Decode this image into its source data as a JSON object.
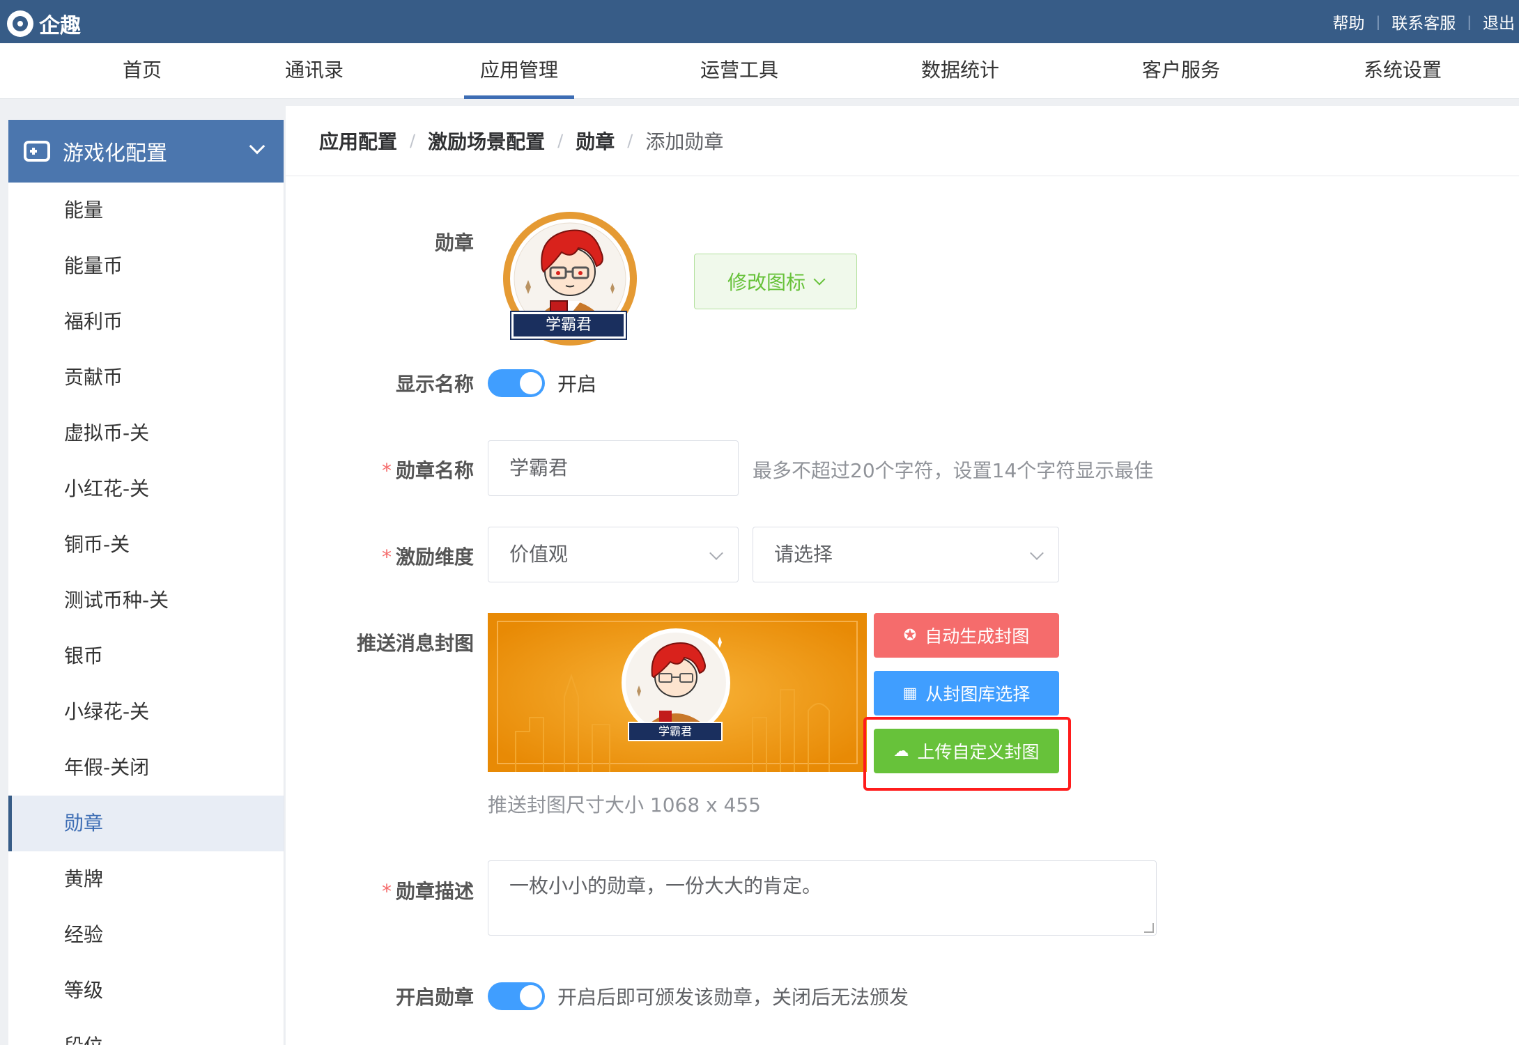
{
  "app": {
    "logo_text": "企趣"
  },
  "toplinks": [
    "帮助",
    "联系客服",
    "退出"
  ],
  "nav": {
    "items": [
      "首页",
      "通讯录",
      "应用管理",
      "运营工具",
      "数据统计",
      "客户服务",
      "系统设置"
    ],
    "active": "应用管理"
  },
  "sidebar": {
    "header": "游戏化配置",
    "items": [
      "能量",
      "能量币",
      "福利币",
      "贡献币",
      "虚拟币-关",
      "小红花-关",
      "铜币-关",
      "测试币种-关",
      "银币",
      "小绿花-关",
      "年假-关闭",
      "勋章",
      "黄牌",
      "经验",
      "等级",
      "段位"
    ],
    "active": "勋章"
  },
  "breadcrumb": [
    "应用配置",
    "激励场景配置",
    "勋章",
    "添加勋章"
  ],
  "form": {
    "badge_label": "勋章",
    "badge_caption": "学霸君",
    "modify_icon_button": "修改图标",
    "show_name_label": "显示名称",
    "show_name_state": "开启",
    "name_label": "勋章名称",
    "name_value": "学霸君",
    "name_hint": "最多不超过20个字符，设置14个字符显示最佳",
    "dimension_label": "激励维度",
    "dimension_value": "价值观",
    "dimension_sub_placeholder": "请选择",
    "cover_label": "推送消息封图",
    "cover_caption": "学霸君",
    "cover_buttons": {
      "auto": "自动生成封图",
      "library": "从封图库选择",
      "upload": "上传自定义封图"
    },
    "cover_size_hint": "推送封图尺寸大小 1068 x 455",
    "desc_label": "勋章描述",
    "desc_value": "一枚小小的勋章，一份大大的肯定。",
    "enable_label": "开启勋章",
    "enable_hint": "开启后即可颁发该勋章，关闭后无法颁发"
  },
  "colors": {
    "topbar": "#375c87",
    "accent": "#409eff",
    "success": "#67c23a",
    "danger": "#f56c6c",
    "cover_bg": "#ee9208",
    "badge_ring": "#e59a33",
    "highlight": "#ff1c1c"
  },
  "icons": [
    "logo-icon",
    "gamepad-icon",
    "chevron-down-icon",
    "compass-icon",
    "grid-icon",
    "cloud-upload-icon"
  ]
}
